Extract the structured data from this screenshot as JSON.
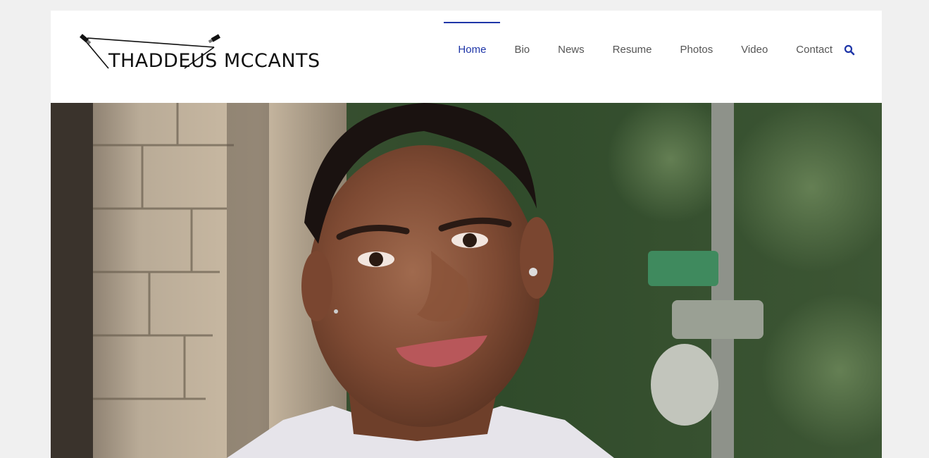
{
  "site": {
    "logo_text": "THADDEUS MCCANTS"
  },
  "nav": {
    "items": [
      {
        "label": "Home",
        "active": true
      },
      {
        "label": "Bio"
      },
      {
        "label": "News"
      },
      {
        "label": "Resume"
      },
      {
        "label": "Photos"
      },
      {
        "label": "Video"
      },
      {
        "label": "Contact"
      }
    ],
    "search_icon": "search-icon"
  },
  "hero": {
    "image": "portrait-photo"
  },
  "colors": {
    "accent": "#1f36a8",
    "background": "#f0f0f0",
    "nav_text": "#555555"
  }
}
